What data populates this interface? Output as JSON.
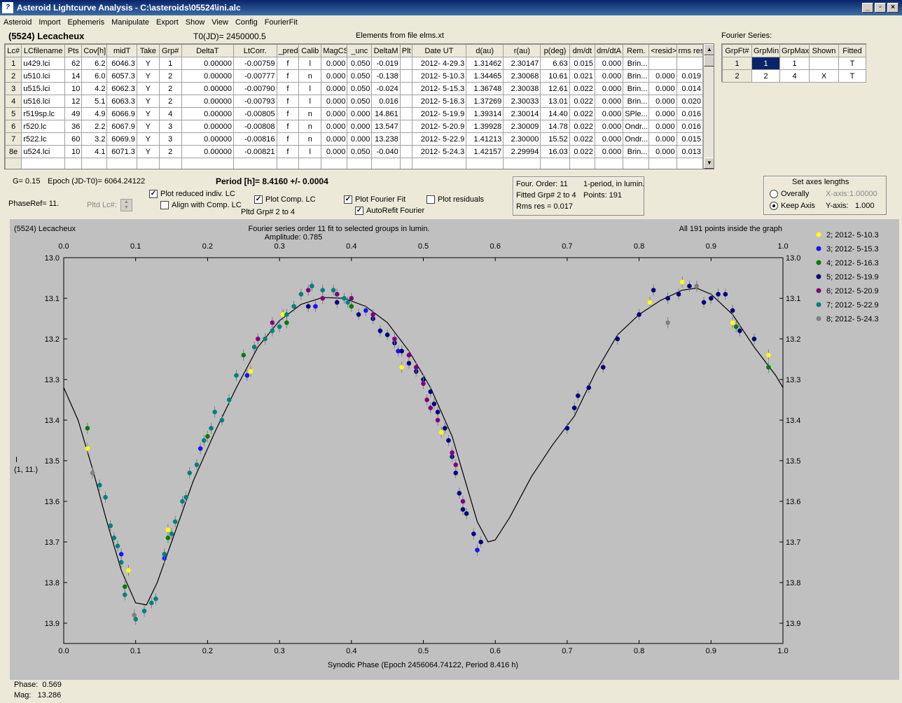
{
  "window": {
    "title": "Asteroid Lightcurve Analysis - C:\\asteroids\\05524\\ini.alc"
  },
  "menu": [
    "Asteroid",
    "Import",
    "Ephemeris",
    "Manipulate",
    "Export",
    "Show",
    "View",
    "Config",
    "FourierFit"
  ],
  "header": {
    "asteroid": "(5524) Lecacheux",
    "t0": "T0(JD)= 2450000.5",
    "elements": "Elements from file elms.xt",
    "fourier_label": "Fourier Series:"
  },
  "lc_table": {
    "columns": [
      "Lc#",
      "LCfilename",
      "Pts",
      "Cov[h]",
      "midT",
      "Take",
      "Grp#",
      "DeltaT",
      "LtCorr.",
      "_pred",
      "Calib",
      "MagCS",
      "_unc",
      "DeltaM",
      "Plt",
      "Date UT",
      "d(au)",
      "r(au)",
      "p(deg)",
      "dm/dt",
      "dm/dtA",
      "Rem.",
      "<resid>",
      "rms res"
    ],
    "rows": [
      [
        "1",
        "u429.lci",
        "62",
        "6.2",
        "6046.3",
        "Y",
        "1",
        "0.00000",
        "-0.00759",
        "f",
        "l",
        "0.000",
        "0.050",
        "-0.019",
        "",
        "2012- 4-29.3",
        "1.31462",
        "2.30147",
        "6.63",
        "0.015",
        "0.000",
        "Brin...",
        "",
        ""
      ],
      [
        "2",
        "u510.lci",
        "14",
        "6.0",
        "6057.3",
        "Y",
        "2",
        "0.00000",
        "-0.00777",
        "f",
        "n",
        "0.000",
        "0.050",
        "-0.138",
        "",
        "2012- 5-10.3",
        "1.34465",
        "2.30068",
        "10.61",
        "0.021",
        "0.000",
        "Brin...",
        "0.000",
        "0.019"
      ],
      [
        "3",
        "u515.lci",
        "10",
        "4.2",
        "6062.3",
        "Y",
        "2",
        "0.00000",
        "-0.00790",
        "f",
        "l",
        "0.000",
        "0.050",
        "-0.024",
        "",
        "2012- 5-15.3",
        "1.36748",
        "2.30038",
        "12.61",
        "0.022",
        "0.000",
        "Brin...",
        "0.000",
        "0.014"
      ],
      [
        "4",
        "u516.lci",
        "12",
        "5.1",
        "6063.3",
        "Y",
        "2",
        "0.00000",
        "-0.00793",
        "f",
        "l",
        "0.000",
        "0.050",
        "0.016",
        "",
        "2012- 5-16.3",
        "1.37269",
        "2.30033",
        "13.01",
        "0.022",
        "0.000",
        "Brin...",
        "0.000",
        "0.020"
      ],
      [
        "5",
        "r519sp.lc",
        "49",
        "4.9",
        "6066.9",
        "Y",
        "4",
        "0.00000",
        "-0.00805",
        "f",
        "n",
        "0.000",
        "0.000",
        "14.861",
        "",
        "2012- 5-19.9",
        "1.39314",
        "2.30014",
        "14.40",
        "0.022",
        "0.000",
        "SPle...",
        "0.000",
        "0.016"
      ],
      [
        "6",
        "r520.lc",
        "36",
        "2.2",
        "6067.9",
        "Y",
        "3",
        "0.00000",
        "-0.00808",
        "f",
        "n",
        "0.000",
        "0.000",
        "13.547",
        "",
        "2012- 5-20.9",
        "1.39928",
        "2.30009",
        "14.78",
        "0.022",
        "0.000",
        "Ondr...",
        "0.000",
        "0.016"
      ],
      [
        "7",
        "r522.lc",
        "60",
        "3.2",
        "6069.9",
        "Y",
        "3",
        "0.00000",
        "-0.00816",
        "f",
        "n",
        "0.000",
        "0.000",
        "13.238",
        "",
        "2012- 5-22.9",
        "1.41213",
        "2.30000",
        "15.52",
        "0.022",
        "0.000",
        "Ondr...",
        "0.000",
        "0.015"
      ],
      [
        "8e",
        "u524.lci",
        "10",
        "4.1",
        "6071.3",
        "Y",
        "2",
        "0.00000",
        "-0.00821",
        "f",
        "l",
        "0.000",
        "0.050",
        "-0.040",
        "",
        "2012- 5-24.3",
        "1.42157",
        "2.29994",
        "16.03",
        "0.022",
        "0.000",
        "Brin...",
        "0.000",
        "0.013"
      ]
    ]
  },
  "fourier_table": {
    "columns": [
      "GrpFt#",
      "GrpMin",
      "GrpMax",
      "Shown",
      "Fitted"
    ],
    "rows": [
      [
        "1",
        "1",
        "1",
        "",
        "T"
      ],
      [
        "2",
        "2",
        "4",
        "X",
        "T"
      ]
    ]
  },
  "controls": {
    "g": "G= 0.15",
    "epoch": "Epoch (JD-T0)= 6064.24122",
    "period": "Period [h]= 8.4160 +/- 0.0004",
    "phaseref": "PhaseRef= 11.",
    "pltd_lc": "Pltd Lc#:",
    "plot_reduced": "Plot reduced indiv. LC",
    "align": "Align with Comp. LC",
    "plot_comp": "Plot Comp. LC",
    "pltd_grp": "Pltd Grp#  2  to   4",
    "plot_fourier": "Plot Fourier Fit",
    "autorefit": "AutoRefit Fourier",
    "plot_resid": "Plot residuals",
    "info1": "Four. Order: 11",
    "info2": "1-period, in lumin.",
    "info3": "Fitted Grp# 2 to 4",
    "info4": "Points: 191",
    "info5": "Rms res     = 0.017",
    "axes_title": "Set axes lengths",
    "overally": "Overally",
    "keep_axis": "Keep Axis",
    "xaxis_label": "X-axis:",
    "xaxis_val": "1.00000",
    "yaxis_label": "Y-axis:",
    "yaxis_val": "1.000"
  },
  "chart_data": {
    "type": "scatter",
    "title_left": "(5524) Lecacheux",
    "title": "Fourier series order 11 fit to selected groups in lumin.",
    "subtitle": "Amplitude: 0.785",
    "title_right": "All 191 points inside the graph",
    "xlabel": "Synodic Phase (Epoch 2456064.74122, Period 8.416 h)",
    "ylabel": "I",
    "ylabel2": "(1, 11.)",
    "xlim": [
      0,
      1
    ],
    "ylim": [
      13.0,
      13.95
    ],
    "xticks": [
      "0.0",
      "0.1",
      "0.2",
      "0.3",
      "0.4",
      "0.5",
      "0.6",
      "0.7",
      "0.8",
      "0.9",
      "1.0"
    ],
    "yticks": [
      "13.0",
      "13.1",
      "13.2",
      "13.3",
      "13.4",
      "13.5",
      "13.6",
      "13.7",
      "13.8",
      "13.9"
    ],
    "grid": false,
    "legend": [
      {
        "label": "2; 2012- 5-10.3",
        "color": "#ffff00"
      },
      {
        "label": "3; 2012- 5-15.3",
        "color": "#1414ff"
      },
      {
        "label": "4; 2012- 5-16.3",
        "color": "#0a7a0a"
      },
      {
        "label": "5; 2012- 5-19.9",
        "color": "#000080"
      },
      {
        "label": "6; 2012- 5-20.9",
        "color": "#800080"
      },
      {
        "label": "7; 2012- 5-22.9",
        "color": "#008080"
      },
      {
        "label": "8; 2012- 5-24.3",
        "color": "#808080"
      }
    ],
    "fit_curve": [
      [
        0.0,
        13.32
      ],
      [
        0.02,
        13.4
      ],
      [
        0.04,
        13.52
      ],
      [
        0.06,
        13.65
      ],
      [
        0.08,
        13.77
      ],
      [
        0.1,
        13.85
      ],
      [
        0.115,
        13.855
      ],
      [
        0.13,
        13.8
      ],
      [
        0.15,
        13.7
      ],
      [
        0.18,
        13.55
      ],
      [
        0.21,
        13.43
      ],
      [
        0.24,
        13.32
      ],
      [
        0.27,
        13.22
      ],
      [
        0.3,
        13.155
      ],
      [
        0.33,
        13.115
      ],
      [
        0.36,
        13.098
      ],
      [
        0.39,
        13.1
      ],
      [
        0.42,
        13.12
      ],
      [
        0.45,
        13.16
      ],
      [
        0.48,
        13.23
      ],
      [
        0.51,
        13.32
      ],
      [
        0.54,
        13.44
      ],
      [
        0.56,
        13.56
      ],
      [
        0.575,
        13.65
      ],
      [
        0.59,
        13.7
      ],
      [
        0.6,
        13.695
      ],
      [
        0.62,
        13.64
      ],
      [
        0.65,
        13.54
      ],
      [
        0.68,
        13.46
      ],
      [
        0.71,
        13.39
      ],
      [
        0.74,
        13.28
      ],
      [
        0.77,
        13.19
      ],
      [
        0.8,
        13.14
      ],
      [
        0.83,
        13.105
      ],
      [
        0.86,
        13.08
      ],
      [
        0.88,
        13.075
      ],
      [
        0.9,
        13.09
      ],
      [
        0.93,
        13.14
      ],
      [
        0.96,
        13.22
      ],
      [
        0.99,
        13.29
      ],
      [
        1.0,
        13.32
      ]
    ],
    "points": [
      [
        0.033,
        13.47,
        0
      ],
      [
        0.09,
        13.77,
        0
      ],
      [
        0.145,
        13.67,
        0
      ],
      [
        0.26,
        13.28,
        0
      ],
      [
        0.305,
        13.14,
        0
      ],
      [
        0.47,
        13.27,
        0
      ],
      [
        0.525,
        13.43,
        0
      ],
      [
        0.815,
        13.11,
        0
      ],
      [
        0.86,
        13.06,
        0
      ],
      [
        0.93,
        13.16,
        0
      ],
      [
        0.98,
        13.24,
        0
      ],
      [
        0.08,
        13.73,
        1
      ],
      [
        0.14,
        13.74,
        1
      ],
      [
        0.19,
        13.47,
        1
      ],
      [
        0.255,
        13.29,
        1
      ],
      [
        0.35,
        13.12,
        1
      ],
      [
        0.42,
        13.13,
        1
      ],
      [
        0.465,
        13.23,
        1
      ],
      [
        0.575,
        13.72,
        1
      ],
      [
        0.033,
        13.42,
        2
      ],
      [
        0.085,
        13.81,
        2
      ],
      [
        0.145,
        13.69,
        2
      ],
      [
        0.2,
        13.44,
        2
      ],
      [
        0.25,
        13.24,
        2
      ],
      [
        0.31,
        13.16,
        2
      ],
      [
        0.4,
        13.12,
        2
      ],
      [
        0.935,
        13.17,
        2
      ],
      [
        0.98,
        13.27,
        2
      ],
      [
        0.34,
        13.12,
        3
      ],
      [
        0.38,
        13.11,
        3
      ],
      [
        0.41,
        13.14,
        3
      ],
      [
        0.43,
        13.15,
        3
      ],
      [
        0.44,
        13.18,
        3
      ],
      [
        0.45,
        13.19,
        3
      ],
      [
        0.46,
        13.21,
        3
      ],
      [
        0.47,
        13.23,
        3
      ],
      [
        0.48,
        13.26,
        3
      ],
      [
        0.49,
        13.28,
        3
      ],
      [
        0.5,
        13.3,
        3
      ],
      [
        0.51,
        13.33,
        3
      ],
      [
        0.515,
        13.36,
        3
      ],
      [
        0.52,
        13.38,
        3
      ],
      [
        0.53,
        13.42,
        3
      ],
      [
        0.535,
        13.45,
        3
      ],
      [
        0.54,
        13.49,
        3
      ],
      [
        0.545,
        13.53,
        3
      ],
      [
        0.55,
        13.58,
        3
      ],
      [
        0.555,
        13.62,
        3
      ],
      [
        0.56,
        13.63,
        3
      ],
      [
        0.57,
        13.68,
        3
      ],
      [
        0.58,
        13.7,
        3
      ],
      [
        0.7,
        13.42,
        3
      ],
      [
        0.71,
        13.37,
        3
      ],
      [
        0.715,
        13.34,
        3
      ],
      [
        0.73,
        13.32,
        3
      ],
      [
        0.75,
        13.27,
        3
      ],
      [
        0.77,
        13.2,
        3
      ],
      [
        0.8,
        13.14,
        3
      ],
      [
        0.82,
        13.08,
        3
      ],
      [
        0.84,
        13.1,
        3
      ],
      [
        0.855,
        13.09,
        3
      ],
      [
        0.87,
        13.07,
        3
      ],
      [
        0.89,
        13.11,
        3
      ],
      [
        0.9,
        13.1,
        3
      ],
      [
        0.91,
        13.09,
        3
      ],
      [
        0.92,
        13.09,
        3
      ],
      [
        0.93,
        13.13,
        3
      ],
      [
        0.94,
        13.18,
        3
      ],
      [
        0.96,
        13.2,
        3
      ],
      [
        0.27,
        13.2,
        4
      ],
      [
        0.29,
        13.16,
        4
      ],
      [
        0.34,
        13.08,
        4
      ],
      [
        0.36,
        13.1,
        4
      ],
      [
        0.38,
        13.09,
        4
      ],
      [
        0.4,
        13.1,
        4
      ],
      [
        0.43,
        13.14,
        4
      ],
      [
        0.46,
        13.2,
        4
      ],
      [
        0.48,
        13.24,
        4
      ],
      [
        0.49,
        13.27,
        4
      ],
      [
        0.5,
        13.31,
        4
      ],
      [
        0.505,
        13.35,
        4
      ],
      [
        0.51,
        13.37,
        4
      ],
      [
        0.52,
        13.4,
        4
      ],
      [
        0.54,
        13.48,
        4
      ],
      [
        0.545,
        13.51,
        4
      ],
      [
        0.555,
        13.6,
        4
      ],
      [
        0.05,
        13.56,
        5
      ],
      [
        0.058,
        13.59,
        5
      ],
      [
        0.065,
        13.66,
        5
      ],
      [
        0.07,
        13.69,
        5
      ],
      [
        0.075,
        13.71,
        5
      ],
      [
        0.08,
        13.75,
        5
      ],
      [
        0.085,
        13.83,
        5
      ],
      [
        0.1,
        13.89,
        5
      ],
      [
        0.112,
        13.87,
        5
      ],
      [
        0.122,
        13.85,
        5
      ],
      [
        0.128,
        13.84,
        5
      ],
      [
        0.14,
        13.73,
        5
      ],
      [
        0.15,
        13.68,
        5
      ],
      [
        0.155,
        13.65,
        5
      ],
      [
        0.165,
        13.6,
        5
      ],
      [
        0.17,
        13.59,
        5
      ],
      [
        0.175,
        13.53,
        5
      ],
      [
        0.185,
        13.51,
        5
      ],
      [
        0.195,
        13.45,
        5
      ],
      [
        0.205,
        13.42,
        5
      ],
      [
        0.21,
        13.38,
        5
      ],
      [
        0.22,
        13.4,
        5
      ],
      [
        0.23,
        13.35,
        5
      ],
      [
        0.24,
        13.29,
        5
      ],
      [
        0.265,
        13.22,
        5
      ],
      [
        0.28,
        13.2,
        5
      ],
      [
        0.29,
        13.18,
        5
      ],
      [
        0.3,
        13.17,
        5
      ],
      [
        0.31,
        13.14,
        5
      ],
      [
        0.32,
        13.12,
        5
      ],
      [
        0.33,
        13.09,
        5
      ],
      [
        0.345,
        13.07,
        5
      ],
      [
        0.36,
        13.08,
        5
      ],
      [
        0.375,
        13.08,
        5
      ],
      [
        0.39,
        13.1,
        5
      ],
      [
        0.395,
        13.11,
        5
      ],
      [
        0.04,
        13.53,
        6
      ],
      [
        0.098,
        13.88,
        6
      ],
      [
        0.84,
        13.16,
        6
      ],
      [
        0.88,
        13.07,
        6
      ]
    ]
  }
}
